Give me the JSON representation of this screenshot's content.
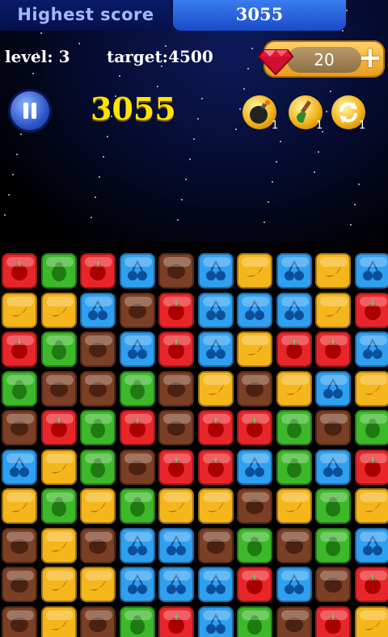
{
  "header": {
    "highest_score_label": "Highest score",
    "highest_score_value": "3055",
    "level_text": "level: 3",
    "target_text": "target:4500",
    "gem_count": "20",
    "plus_label": "+"
  },
  "game": {
    "score": "3055",
    "tools": [
      {
        "name": "bomb",
        "count": "1"
      },
      {
        "name": "brush",
        "count": "1"
      },
      {
        "name": "refresh",
        "count": "1"
      }
    ]
  },
  "colors": {
    "red": "#e8262a",
    "green": "#3cb82a",
    "blue": "#2f9ff0",
    "brown": "#7a3f24",
    "yellow": "#f5b61c",
    "score": "#ffe400"
  },
  "board": {
    "legend": {
      "R": "apple",
      "G": "pear",
      "B": "cherry",
      "N": "coconut",
      "Y": "banana"
    },
    "rows": [
      [
        "R",
        "G",
        "R",
        "B",
        "N",
        "B",
        "Y",
        "B",
        "Y",
        "B"
      ],
      [
        "Y",
        "Y",
        "B",
        "N",
        "R",
        "B",
        "B",
        "B",
        "Y",
        "R"
      ],
      [
        "R",
        "G",
        "N",
        "B",
        "R",
        "B",
        "Y",
        "R",
        "R",
        "B"
      ],
      [
        "G",
        "N",
        "N",
        "G",
        "N",
        "Y",
        "N",
        "Y",
        "B",
        "Y"
      ],
      [
        "N",
        "R",
        "G",
        "R",
        "N",
        "R",
        "R",
        "G",
        "N",
        "G"
      ],
      [
        "B",
        "Y",
        "G",
        "N",
        "R",
        "R",
        "B",
        "G",
        "B",
        "R"
      ],
      [
        "Y",
        "G",
        "Y",
        "G",
        "Y",
        "Y",
        "N",
        "Y",
        "G",
        "Y"
      ],
      [
        "N",
        "Y",
        "N",
        "B",
        "B",
        "N",
        "G",
        "N",
        "G",
        "B"
      ],
      [
        "N",
        "Y",
        "Y",
        "B",
        "B",
        "B",
        "R",
        "B",
        "N",
        "R"
      ],
      [
        "N",
        "Y",
        "N",
        "G",
        "R",
        "B",
        "G",
        "N",
        "R",
        "Y"
      ]
    ]
  }
}
